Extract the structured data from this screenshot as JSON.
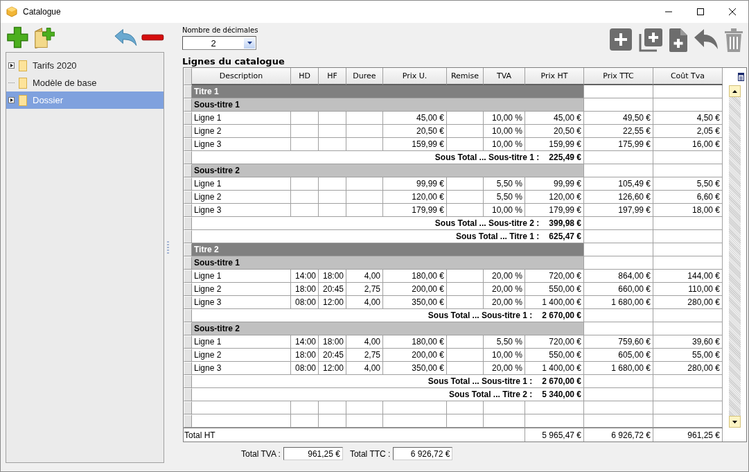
{
  "window": {
    "title": "Catalogue"
  },
  "tree": {
    "items": [
      {
        "label": "Tarifs 2020",
        "expandable": true,
        "selected": false
      },
      {
        "label": "Modèle de base",
        "expandable": false,
        "selected": false
      },
      {
        "label": "Dossier",
        "expandable": true,
        "selected": true
      }
    ]
  },
  "decimals": {
    "label": "Nombre de décimales",
    "value": "2"
  },
  "section_title": "Lignes du catalogue",
  "table": {
    "columns": [
      "Description",
      "HD",
      "HF",
      "Duree",
      "Prix U.",
      "Remise",
      "TVA",
      "Prix HT",
      "Prix TTC",
      "Coût Tva"
    ],
    "rows": [
      {
        "kind": "title",
        "label": "Titre 1"
      },
      {
        "kind": "subtitle",
        "label": "Sous-titre 1"
      },
      {
        "kind": "line",
        "description": "Ligne 1",
        "prix_u": "45,00 €",
        "tva": "10,00 %",
        "prix_ht": "45,00 €",
        "prix_ttc": "49,50 €",
        "cout_tva": "4,50 €"
      },
      {
        "kind": "line",
        "description": "Ligne 2",
        "prix_u": "20,50 €",
        "tva": "10,00 %",
        "prix_ht": "20,50 €",
        "prix_ttc": "22,55 €",
        "cout_tva": "2,05 €"
      },
      {
        "kind": "line",
        "description": "Ligne 3",
        "prix_u": "159,99 €",
        "tva": "10,00 %",
        "prix_ht": "159,99 €",
        "prix_ttc": "175,99 €",
        "cout_tva": "16,00 €"
      },
      {
        "kind": "subtotal",
        "label": "Sous Total ... Sous-titre 1 :",
        "value": "225,49 €"
      },
      {
        "kind": "subtitle",
        "label": "Sous-titre 2"
      },
      {
        "kind": "line",
        "description": "Ligne 1",
        "prix_u": "99,99 €",
        "tva": "5,50 %",
        "prix_ht": "99,99 €",
        "prix_ttc": "105,49 €",
        "cout_tva": "5,50 €"
      },
      {
        "kind": "line",
        "description": "Ligne 2",
        "prix_u": "120,00 €",
        "tva": "5,50 %",
        "prix_ht": "120,00 €",
        "prix_ttc": "126,60 €",
        "cout_tva": "6,60 €"
      },
      {
        "kind": "line",
        "description": "Ligne 3",
        "prix_u": "179,99 €",
        "tva": "10,00 %",
        "prix_ht": "179,99 €",
        "prix_ttc": "197,99 €",
        "cout_tva": "18,00 €"
      },
      {
        "kind": "subtotal",
        "label": "Sous Total ... Sous-titre 2 :",
        "value": "399,98 €"
      },
      {
        "kind": "subtotal",
        "label": "Sous Total ... Titre 1 :",
        "value": "625,47 €"
      },
      {
        "kind": "title",
        "label": "Titre 2"
      },
      {
        "kind": "subtitle",
        "label": "Sous-titre 1"
      },
      {
        "kind": "line",
        "description": "Ligne 1",
        "hd": "14:00",
        "hf": "18:00",
        "duree": "4,00",
        "prix_u": "180,00 €",
        "tva": "20,00 %",
        "prix_ht": "720,00 €",
        "prix_ttc": "864,00 €",
        "cout_tva": "144,00 €"
      },
      {
        "kind": "line",
        "description": "Ligne 2",
        "hd": "18:00",
        "hf": "20:45",
        "duree": "2,75",
        "prix_u": "200,00 €",
        "tva": "20,00 %",
        "prix_ht": "550,00 €",
        "prix_ttc": "660,00 €",
        "cout_tva": "110,00 €"
      },
      {
        "kind": "line",
        "description": "Ligne 3",
        "hd": "08:00",
        "hf": "12:00",
        "duree": "4,00",
        "prix_u": "350,00 €",
        "tva": "20,00 %",
        "prix_ht": "1 400,00 €",
        "prix_ttc": "1 680,00 €",
        "cout_tva": "280,00 €"
      },
      {
        "kind": "subtotal",
        "label": "Sous Total ... Sous-titre 1 :",
        "value": "2 670,00 €"
      },
      {
        "kind": "subtitle",
        "label": "Sous-titre 2"
      },
      {
        "kind": "line",
        "description": "Ligne 1",
        "hd": "14:00",
        "hf": "18:00",
        "duree": "4,00",
        "prix_u": "180,00 €",
        "tva": "5,50 %",
        "prix_ht": "720,00 €",
        "prix_ttc": "759,60 €",
        "cout_tva": "39,60 €"
      },
      {
        "kind": "line",
        "description": "Ligne 2",
        "hd": "18:00",
        "hf": "20:45",
        "duree": "2,75",
        "prix_u": "200,00 €",
        "tva": "10,00 %",
        "prix_ht": "550,00 €",
        "prix_ttc": "605,00 €",
        "cout_tva": "55,00 €"
      },
      {
        "kind": "line",
        "description": "Ligne 3",
        "hd": "08:00",
        "hf": "12:00",
        "duree": "4,00",
        "prix_u": "350,00 €",
        "tva": "20,00 %",
        "prix_ht": "1 400,00 €",
        "prix_ttc": "1 680,00 €",
        "cout_tva": "280,00 €"
      },
      {
        "kind": "subtotal",
        "label": "Sous Total ... Sous-titre 1 :",
        "value": "2 670,00 €"
      },
      {
        "kind": "subtotal",
        "label": "Sous Total ... Titre 2 :",
        "value": "5 340,00 €"
      },
      {
        "kind": "empty"
      },
      {
        "kind": "empty"
      }
    ],
    "total": {
      "label": "Total HT",
      "prix_ht": "5 965,47 €",
      "prix_ttc": "6 926,72 €",
      "cout_tva": "961,25 €"
    }
  },
  "footer": {
    "tva_label": "Total TVA :",
    "tva_value": "961,25 €",
    "ttc_label": "Total TTC :",
    "ttc_value": "6 926,72 €"
  }
}
